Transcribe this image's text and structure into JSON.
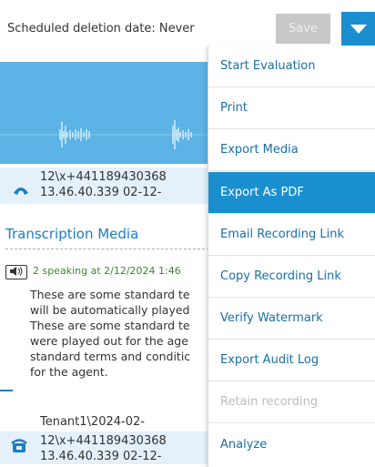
{
  "header": {
    "scheduled_deletion": "Scheduled deletion date: Never",
    "save_label": "Save"
  },
  "recording1": {
    "line1": "12\\x+441189430368",
    "line2": "13.46.40.339 02-12-"
  },
  "transcription": {
    "title": "Transcription Media",
    "speaker_line": "2 speaking at 2/12/2024 1:46",
    "lines": [
      "These are some standard te",
      "will be automatically played",
      "These are some standard te",
      "were played out for the age",
      "standard terms and conditic",
      "for the agent."
    ]
  },
  "recording2": {
    "line0": "Tenant1\\2024-02-",
    "line1": "12\\x+441189430368",
    "line2": "13.46.40.339 02-12-"
  },
  "menu": {
    "items": [
      {
        "label": "Start Evaluation",
        "state": "normal"
      },
      {
        "label": "Print",
        "state": "normal"
      },
      {
        "label": "Export Media",
        "state": "normal"
      },
      {
        "label": "Export As PDF",
        "state": "active"
      },
      {
        "label": "Email Recording Link",
        "state": "normal"
      },
      {
        "label": "Copy Recording Link",
        "state": "normal"
      },
      {
        "label": "Verify Watermark",
        "state": "normal"
      },
      {
        "label": "Export Audit Log",
        "state": "normal"
      },
      {
        "label": "Retain recording",
        "state": "disabled"
      },
      {
        "label": "Analyze",
        "state": "normal"
      }
    ]
  },
  "colors": {
    "accent": "#1a8fd0",
    "waveform_bg": "#5cb3e6",
    "speaker_text": "#3a8a2a"
  }
}
